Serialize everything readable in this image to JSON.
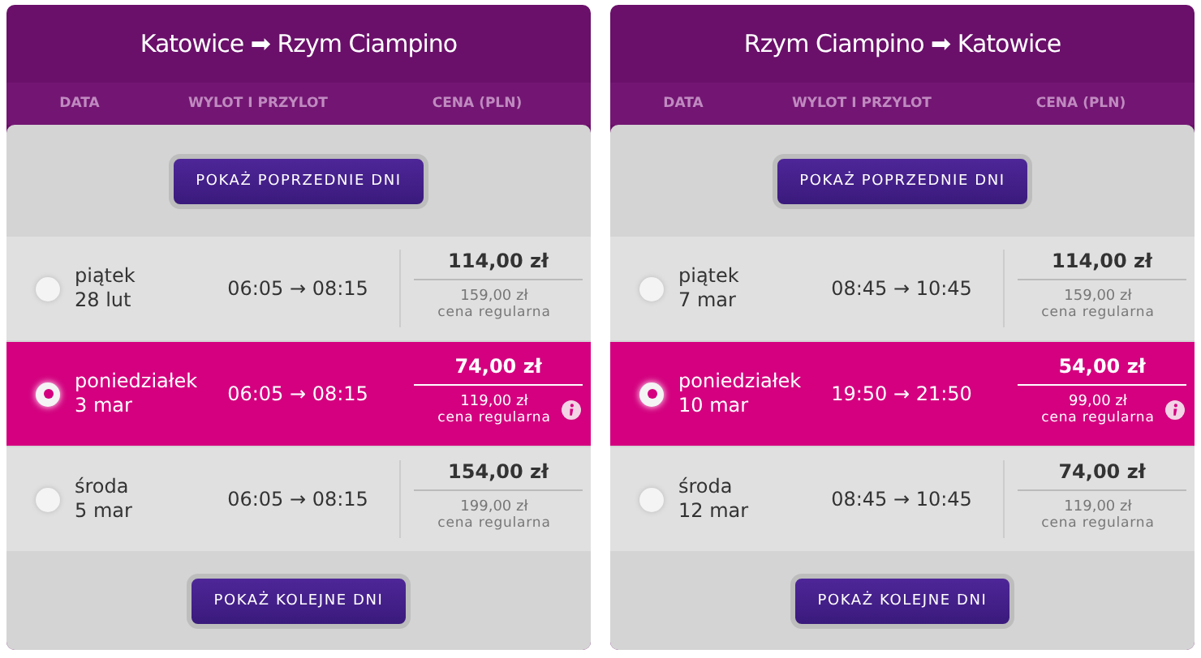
{
  "panels": [
    {
      "title": "Katowice ➡ Rzym Ciampino",
      "columns": [
        "DATA",
        "WYLOT I PRZYLOT",
        "CENA (PLN)"
      ],
      "prev_button": "POKAŻ POPRZEDNIE DNI",
      "next_button": "POKAŻ KOLEJNE DNI",
      "rows": [
        {
          "day": "piątek",
          "date": "28 lut",
          "times": "06:05 → 08:15",
          "price": "114,00 zł",
          "regular_price": "159,00 zł",
          "regular_label": "cena regularna",
          "selected": false,
          "info": false
        },
        {
          "day": "poniedziałek",
          "date": "3 mar",
          "times": "06:05 → 08:15",
          "price": "74,00 zł",
          "regular_price": "119,00 zł",
          "regular_label": "cena regularna",
          "selected": true,
          "info": true
        },
        {
          "day": "środa",
          "date": "5 mar",
          "times": "06:05 → 08:15",
          "price": "154,00 zł",
          "regular_price": "199,00 zł",
          "regular_label": "cena regularna",
          "selected": false,
          "info": false
        }
      ]
    },
    {
      "title": "Rzym Ciampino ➡ Katowice",
      "columns": [
        "DATA",
        "WYLOT I PRZYLOT",
        "CENA (PLN)"
      ],
      "prev_button": "POKAŻ POPRZEDNIE DNI",
      "next_button": "POKAŻ KOLEJNE DNI",
      "rows": [
        {
          "day": "piątek",
          "date": "7 mar",
          "times": "08:45 → 10:45",
          "price": "114,00 zł",
          "regular_price": "159,00 zł",
          "regular_label": "cena regularna",
          "selected": false,
          "info": false
        },
        {
          "day": "poniedziałek",
          "date": "10 mar",
          "times": "19:50 → 21:50",
          "price": "54,00 zł",
          "regular_price": "99,00 zł",
          "regular_label": "cena regularna",
          "selected": true,
          "info": true
        },
        {
          "day": "środa",
          "date": "12 mar",
          "times": "08:45 → 10:45",
          "price": "74,00 zł",
          "regular_price": "119,00 zł",
          "regular_label": "cena regularna",
          "selected": false,
          "info": false
        }
      ]
    }
  ]
}
